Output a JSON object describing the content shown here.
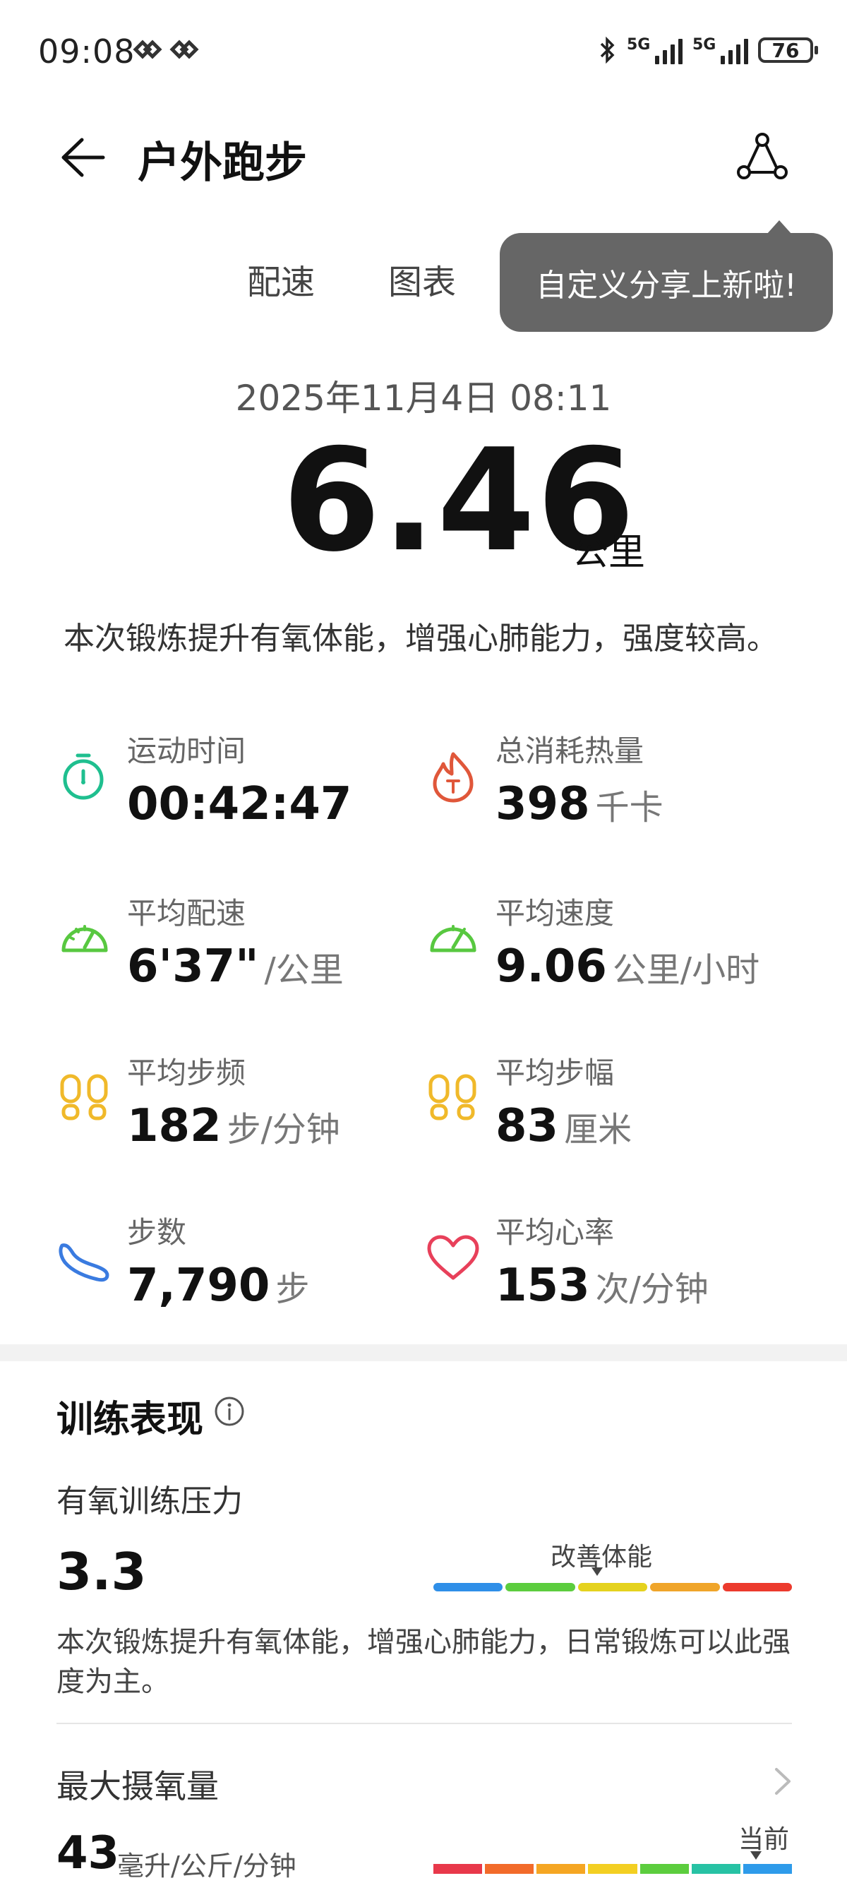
{
  "status_bar": {
    "time": "09:08",
    "network_label_1": "5G",
    "network_label_2": "5G",
    "battery": "76"
  },
  "header": {
    "title": "户外跑步"
  },
  "tabs": [
    {
      "label": "配速"
    },
    {
      "label": "图表"
    }
  ],
  "tooltip": {
    "text": "自定义分享上新啦!"
  },
  "workout": {
    "date": "2025年11月4日 08:11",
    "distance": "6.46",
    "distance_unit": "公里",
    "summary": "本次锻炼提升有氧体能，增强心肺能力，强度较高。"
  },
  "metrics": [
    {
      "label": "运动时间",
      "value": "00:42:47",
      "unit": "",
      "icon": "stopwatch-icon",
      "color": "#1fbf8f"
    },
    {
      "label": "总消耗热量",
      "value": "398",
      "unit": "千卡",
      "icon": "flame-icon",
      "color": "#e0573a"
    },
    {
      "label": "平均配速",
      "value": "6'37\"",
      "unit": "/公里",
      "icon": "speedometer-icon",
      "color": "#58c840"
    },
    {
      "label": "平均速度",
      "value": "9.06",
      "unit": "公里/小时",
      "icon": "gauge-icon",
      "color": "#58c840"
    },
    {
      "label": "平均步频",
      "value": "182",
      "unit": "步/分钟",
      "icon": "footprints-icon",
      "color": "#f0b92a"
    },
    {
      "label": "平均步幅",
      "value": "83",
      "unit": "厘米",
      "icon": "footprints-icon",
      "color": "#f0b92a"
    },
    {
      "label": "步数",
      "value": "7,790",
      "unit": "步",
      "icon": "shoe-icon",
      "color": "#3a7be0"
    },
    {
      "label": "平均心率",
      "value": "153",
      "unit": "次/分钟",
      "icon": "heart-icon",
      "color": "#e8405a"
    }
  ],
  "training": {
    "section_title": "训练表现",
    "aerobic": {
      "label": "有氧训练压力",
      "value": "3.3",
      "scale_label": "改善体能",
      "scale_colors": [
        "#2f8fe8",
        "#5ccd3e",
        "#e5d21e",
        "#f0a52a",
        "#ec3a2d"
      ],
      "description": "本次锻炼提升有氧体能，增强心肺能力，日常锻炼可以此强度为主。"
    },
    "vo2max": {
      "label": "最大摄氧量",
      "value": "43",
      "unit": "毫升/公斤/分钟",
      "current_label": "当前",
      "scale_colors": [
        "#e8384a",
        "#f26b2a",
        "#f5a623",
        "#f3cf22",
        "#5ccd3e",
        "#27c2a4",
        "#2e9bea"
      ]
    }
  }
}
